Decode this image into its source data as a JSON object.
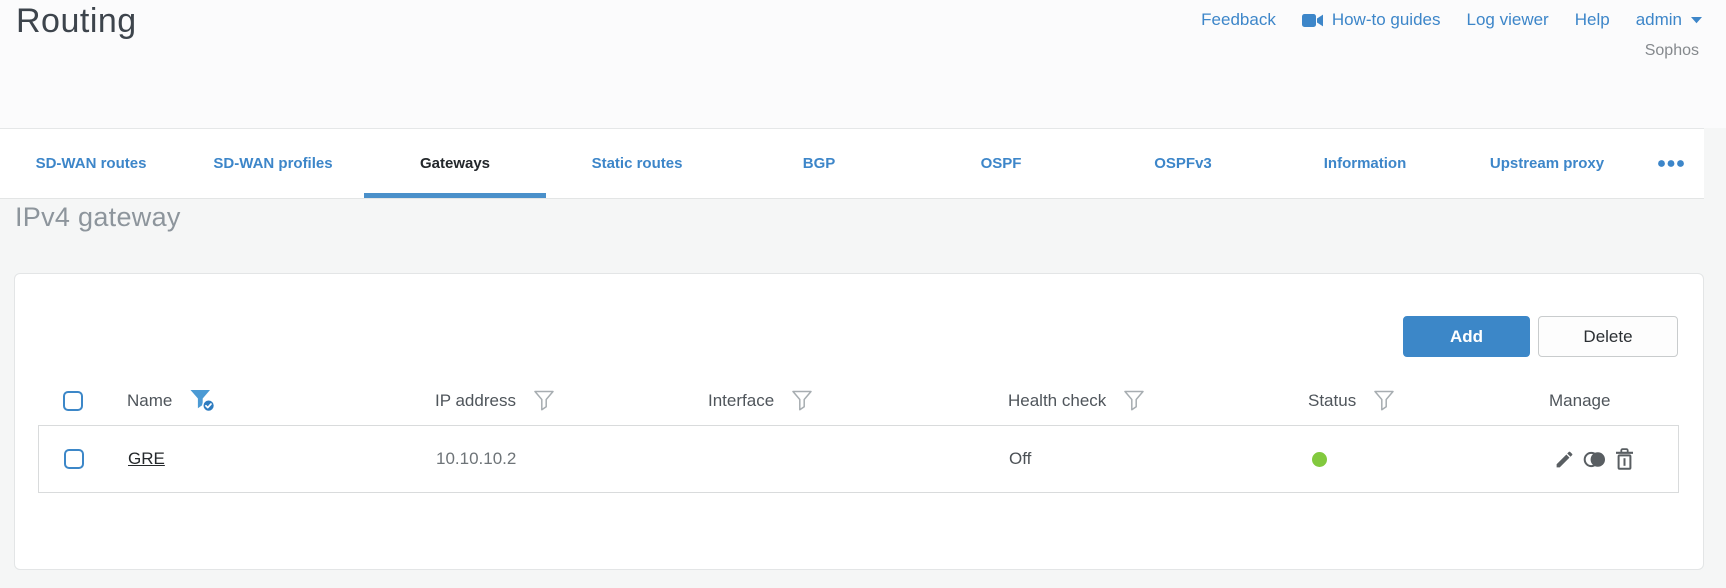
{
  "header": {
    "title": "Routing",
    "links": [
      {
        "label": "Feedback"
      },
      {
        "label": "How-to guides",
        "icon": "video-camera-icon"
      },
      {
        "label": "Log viewer"
      },
      {
        "label": "Help"
      },
      {
        "label": "admin",
        "icon": "caret-down-icon"
      }
    ],
    "tenant": "Sophos"
  },
  "tabs": {
    "active_tab": "Gateways",
    "items": [
      "SD-WAN routes",
      "SD-WAN profiles",
      "Gateways",
      "Static routes",
      "BGP",
      "OSPF",
      "OSPFv3",
      "Information",
      "Upstream proxy"
    ],
    "more_icon": "ellipsis-icon"
  },
  "section": {
    "title": "IPv4 gateway"
  },
  "toolbar": {
    "add_label": "Add",
    "delete_label": "Delete"
  },
  "table": {
    "columns": [
      {
        "label": "Name",
        "filter": "active"
      },
      {
        "label": "IP address",
        "filter": "default"
      },
      {
        "label": "Interface",
        "filter": "default"
      },
      {
        "label": "Health check",
        "filter": "default"
      },
      {
        "label": "Status",
        "filter": "default"
      },
      {
        "label": "Manage",
        "filter": "none"
      }
    ],
    "rows": [
      {
        "name": "GRE",
        "ip_address": "10.10.10.2",
        "interface": "",
        "health_check": "Off",
        "status": "up",
        "status_color": "#82c93e",
        "actions": [
          "edit",
          "clone",
          "delete"
        ]
      }
    ]
  },
  "colors": {
    "accent_blue": "#3d86c9",
    "button_blue": "#3c87c8",
    "tab_underline": "#4a90ca",
    "status_green": "#82c93e"
  }
}
